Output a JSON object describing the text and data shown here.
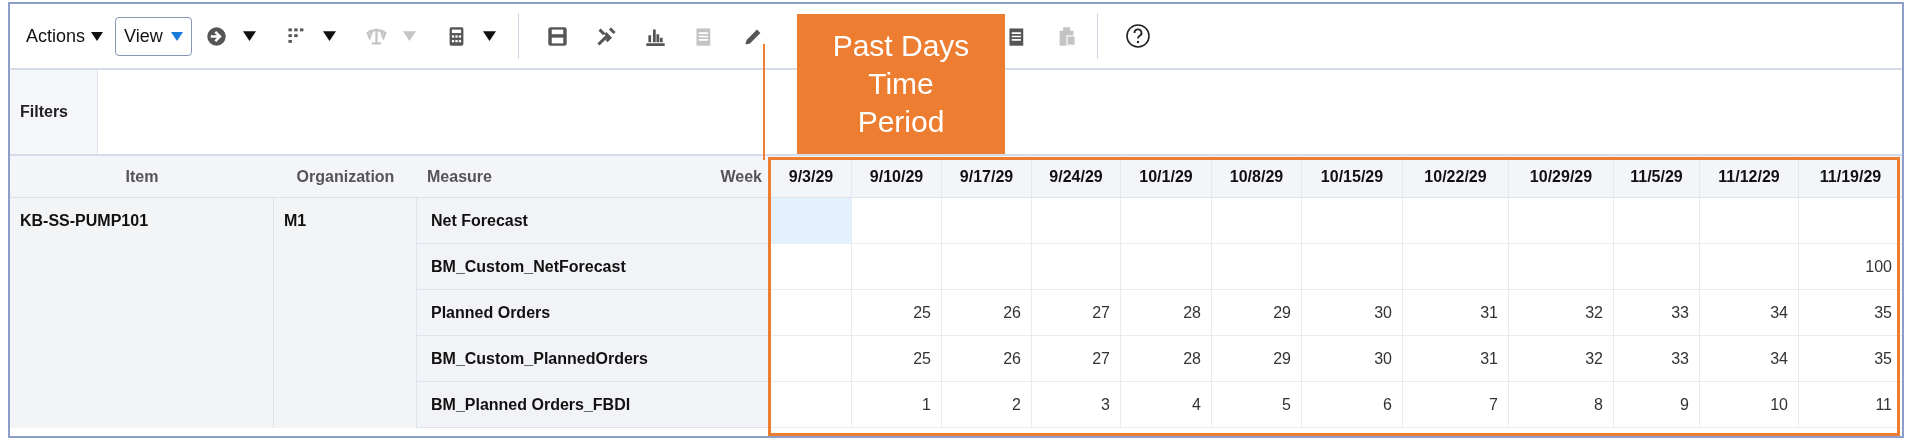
{
  "toolbar": {
    "menus": [
      {
        "label": "Actions"
      }
    ],
    "view_button": {
      "label": "View"
    },
    "items": [
      {
        "kind": "icon",
        "disabled": false
      },
      {
        "kind": "caret",
        "disabled": false
      },
      {
        "kind": "icon",
        "disabled": false
      },
      {
        "kind": "caret",
        "disabled": false
      },
      {
        "kind": "icon",
        "disabled": true
      },
      {
        "kind": "caret",
        "disabled": true
      },
      {
        "kind": "icon",
        "disabled": false
      },
      {
        "kind": "caret",
        "disabled": false
      },
      {
        "kind": "separator"
      },
      {
        "kind": "icon",
        "disabled": false
      },
      {
        "kind": "icon",
        "disabled": false
      },
      {
        "kind": "icon",
        "disabled": false
      },
      {
        "kind": "icon",
        "disabled": true
      },
      {
        "kind": "icon",
        "disabled": false
      },
      {
        "kind": "icon",
        "disabled": false
      },
      {
        "kind": "icon",
        "disabled": true
      },
      {
        "kind": "separator"
      },
      {
        "kind": "help"
      }
    ]
  },
  "filters": {
    "label": "Filters"
  },
  "table": {
    "columns": [
      "Item",
      "Organization",
      "Measure",
      "Week"
    ],
    "weeks": [
      "9/3/29",
      "9/10/29",
      "9/17/29",
      "9/24/29",
      "10/1/29",
      "10/8/29",
      "10/15/29",
      "10/22/29",
      "10/29/29",
      "11/5/29",
      "11/12/29",
      "11/19/29"
    ],
    "item": "KB-SS-PUMP101",
    "organization": "M1",
    "rows": [
      {
        "measure": "Net Forecast",
        "cells": [
          {
            "selected": true
          },
          {
            "selected": false
          },
          {
            "selected": false
          },
          {
            "selected": false
          },
          {
            "selected": false
          },
          {
            "selected": false
          },
          {
            "selected": false
          },
          {
            "selected": false
          },
          {
            "selected": false
          },
          {
            "selected": false
          },
          {
            "selected": false
          },
          {
            "selected": false
          }
        ]
      },
      {
        "measure": "BM_Custom_NetForecast",
        "cells": [
          {
            "selected": false
          },
          {
            "selected": false
          },
          {
            "selected": false
          },
          {
            "selected": false
          },
          {
            "selected": false
          },
          {
            "selected": false
          },
          {
            "selected": false
          },
          {
            "selected": false
          },
          {
            "selected": false
          },
          {
            "selected": false
          },
          {
            "selected": false
          },
          {
            "selected": false,
            "value": "100"
          }
        ]
      },
      {
        "measure": "Planned Orders",
        "cells": [
          {
            "selected": false
          },
          {
            "selected": false,
            "value": "25"
          },
          {
            "selected": false,
            "value": "26"
          },
          {
            "selected": false,
            "value": "27"
          },
          {
            "selected": false,
            "value": "28"
          },
          {
            "selected": false,
            "value": "29"
          },
          {
            "selected": false,
            "value": "30"
          },
          {
            "selected": false,
            "value": "31"
          },
          {
            "selected": false,
            "value": "32"
          },
          {
            "selected": false,
            "value": "33"
          },
          {
            "selected": false,
            "value": "34"
          },
          {
            "selected": false,
            "value": "35"
          }
        ]
      },
      {
        "measure": "BM_Custom_PlannedOrders",
        "cells": [
          {
            "selected": false
          },
          {
            "selected": false,
            "value": "25"
          },
          {
            "selected": false,
            "value": "26"
          },
          {
            "selected": false,
            "value": "27"
          },
          {
            "selected": false,
            "value": "28"
          },
          {
            "selected": false,
            "value": "29"
          },
          {
            "selected": false,
            "value": "30"
          },
          {
            "selected": false,
            "value": "31"
          },
          {
            "selected": false,
            "value": "32"
          },
          {
            "selected": false,
            "value": "33"
          },
          {
            "selected": false,
            "value": "34"
          },
          {
            "selected": false,
            "value": "35"
          }
        ]
      },
      {
        "measure": "BM_Planned Orders_FBDI",
        "cells": [
          {
            "selected": false
          },
          {
            "selected": false,
            "value": "1"
          },
          {
            "selected": false,
            "value": "2"
          },
          {
            "selected": false,
            "value": "3"
          },
          {
            "selected": false,
            "value": "4"
          },
          {
            "selected": false,
            "value": "5"
          },
          {
            "selected": false,
            "value": "6"
          },
          {
            "selected": false,
            "value": "7"
          },
          {
            "selected": false,
            "value": "8"
          },
          {
            "selected": false,
            "value": "9"
          },
          {
            "selected": false,
            "value": "10"
          },
          {
            "selected": false,
            "value": "11"
          }
        ]
      }
    ]
  },
  "callout": {
    "lines": [
      "Past Days",
      "Time",
      "Period"
    ]
  }
}
